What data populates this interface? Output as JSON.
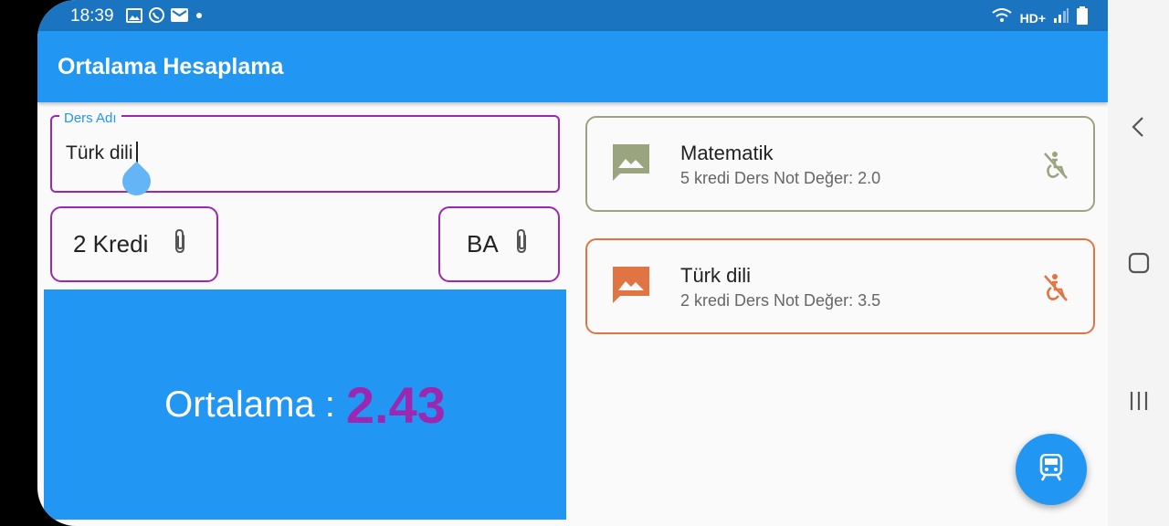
{
  "status_bar": {
    "time": "18:39",
    "network": "HD+",
    "icons_left": [
      "image-icon",
      "whatsapp-icon",
      "mail-icon",
      "dot-icon"
    ],
    "icons_right": [
      "wifi-icon",
      "signal-icon",
      "battery-icon"
    ]
  },
  "app_bar": {
    "title": "Ortalama Hesaplama"
  },
  "form": {
    "ders_adi_label": "Ders Adı",
    "ders_adi_value": "Türk dili",
    "kredi_value": "2 Kredi",
    "not_value": "BA"
  },
  "result": {
    "label": "Ortalama : ",
    "value": "2.43"
  },
  "courses": [
    {
      "name": "Matematik",
      "detail": "5 kredi Ders Not Değer: 2.0",
      "color": "#9aa57f"
    },
    {
      "name": "Türk dili",
      "detail": "2 kredi Ders Not Değer: 3.5",
      "color": "#e07442"
    }
  ],
  "fab": {
    "icon": "train-icon"
  },
  "colors": {
    "primary": "#2196f3",
    "status_bar": "#1a74c0",
    "accent": "#9c27b0"
  },
  "nav": {
    "icons": [
      "back-icon",
      "home-icon",
      "recents-icon"
    ]
  }
}
